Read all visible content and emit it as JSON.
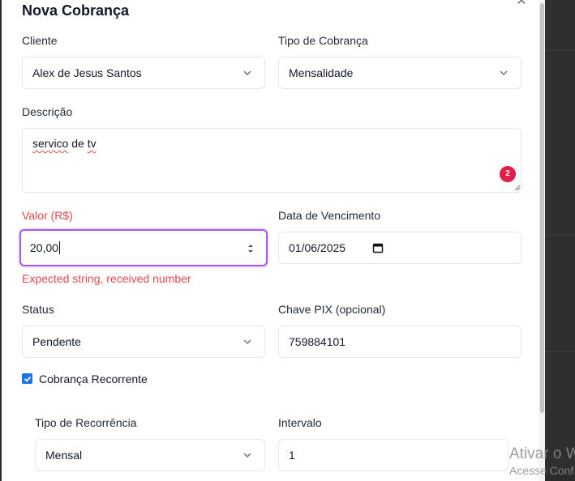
{
  "modal": {
    "title": "Nova Cobrança",
    "close_icon": "close-icon"
  },
  "form": {
    "cliente": {
      "label": "Cliente",
      "value": "Alex de Jesus Santos"
    },
    "tipo_cobranca": {
      "label": "Tipo de Cobrança",
      "value": "Mensalidade"
    },
    "descricao": {
      "label": "Descrição",
      "word1": "servico",
      "word2": " de ",
      "word3": "tv",
      "badge": "2"
    },
    "valor": {
      "label": "Valor (R$)",
      "value": "20,00",
      "error": "Expected string, received number"
    },
    "data_vencimento": {
      "label": "Data de Vencimento",
      "value": "01/06/2025"
    },
    "status": {
      "label": "Status",
      "value": "Pendente"
    },
    "chave_pix": {
      "label": "Chave PIX (opcional)",
      "value": "759884101"
    },
    "recorrente": {
      "label": "Cobrança Recorrente",
      "checked": true
    },
    "tipo_recorrencia": {
      "label": "Tipo de Recorrência",
      "value": "Mensal"
    },
    "intervalo": {
      "label": "Intervalo",
      "value": "1"
    }
  },
  "watermark": {
    "line1": "Ativar o W",
    "line2": "Acesse Conf"
  },
  "colors": {
    "error": "#e5484d",
    "focus": "#a855f7",
    "badge": "#e11d48",
    "checkbox": "#1a73e8"
  }
}
